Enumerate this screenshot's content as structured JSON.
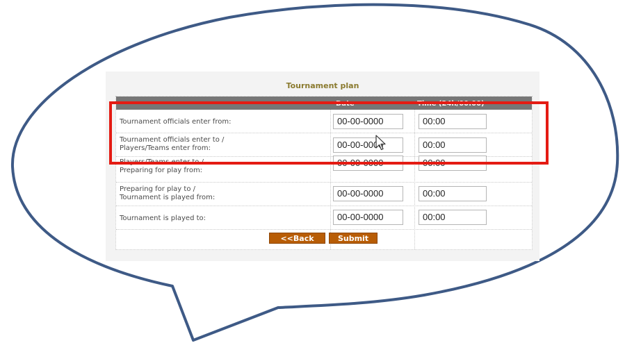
{
  "form": {
    "title": "Tournament plan",
    "columns": {
      "date": "Date",
      "time": "Time (24h/00:00)"
    },
    "rows": [
      {
        "label": "Tournament officials enter from:",
        "date": "00-00-0000",
        "time": "00:00"
      },
      {
        "label": "Tournament officials enter to /\nPlayers/Teams enter from:",
        "date": "00-00-0000",
        "time": "00:00"
      },
      {
        "label": "Players/Teams enter to /\nPreparing for play from:",
        "date": "00-00-0000",
        "time": "00:00"
      },
      {
        "label": "Preparing for play to /\nTournament is played from:",
        "date": "00-00-0000",
        "time": "00:00"
      },
      {
        "label": "Tournament is played to:",
        "date": "00-00-0000",
        "time": "00:00"
      }
    ],
    "buttons": {
      "back": "<<Back",
      "submit": "Submit"
    }
  },
  "colors": {
    "bubble_outline": "#3e5a86",
    "highlight": "#e41b13",
    "button": "#b85d06",
    "header": "#767676",
    "title": "#8a7a2e"
  },
  "icons": {
    "cursor": "mouse-pointer-icon"
  }
}
